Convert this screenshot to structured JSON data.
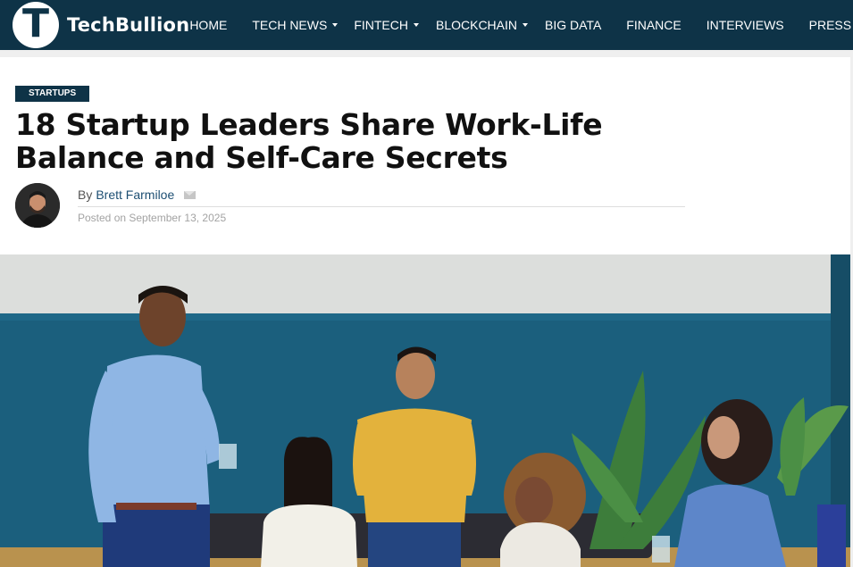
{
  "header": {
    "logo_letter": "T",
    "logo_text": "TechBullion",
    "nav": [
      {
        "label": "HOME",
        "dropdown": false
      },
      {
        "label": "TECH NEWS",
        "dropdown": true
      },
      {
        "label": "FINTECH",
        "dropdown": true
      },
      {
        "label": "BLOCKCHAIN",
        "dropdown": true
      },
      {
        "label": "BIG DATA",
        "dropdown": false
      },
      {
        "label": "FINANCE",
        "dropdown": false
      },
      {
        "label": "INTERVIEWS",
        "dropdown": false
      },
      {
        "label": "PRESS R",
        "dropdown": false
      }
    ]
  },
  "article": {
    "category": "STARTUPS",
    "title": "18 Startup Leaders Share Work-Life Balance and Self-Care Secrets",
    "by_prefix": "By",
    "author": "Brett Farmiloe",
    "posted": "Posted on September 13, 2025"
  },
  "colors": {
    "brand_navy": "#0e3347",
    "link": "#1e4f73",
    "wall_teal": "#1b5f7d"
  },
  "icons": [
    "mail-icon",
    "chevron-down-icon"
  ]
}
